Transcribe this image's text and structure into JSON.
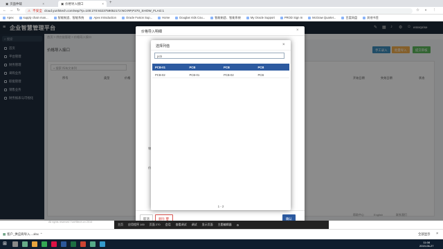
{
  "browser": {
    "tabs": [
      {
        "label": "页面仲裁",
        "active": false
      },
      {
        "label": "价格导入接口",
        "active": true
      }
    ],
    "insecure_label": "不安全",
    "url": "cloud.yunhitech.com/sep/?p=100:270:9323759052172:NO:RP,P270_SHOW_FLAG:1",
    "bookmarks": [
      "Apex",
      "supply chain man...",
      "智能制造、智能系统",
      "Apex Introduction",
      "Oracle Fusion Sup...",
      "Home",
      "Douglas Vids Cou...",
      "智能制造、智能系统",
      "My Oracle Support",
      "PROD Sign In",
      "McGraw Quarter...",
      "百度网盘",
      "其他书签"
    ]
  },
  "app": {
    "title": "企业智慧管理平台",
    "user": "enterprise"
  },
  "sidebar": {
    "search_placeholder": "搜索",
    "items": [
      {
        "label": "首页",
        "active": false
      },
      {
        "label": "平台管理",
        "active": false
      },
      {
        "label": "财务管理",
        "active": false
      },
      {
        "label": "采购业务",
        "active": false
      },
      {
        "label": "职能管理",
        "active": false
      },
      {
        "label": "销售业务",
        "active": false
      },
      {
        "label": "财务报表与可视化",
        "active": false
      }
    ]
  },
  "breadcrumb": "首页 > 供应链管理 > 价格导入接口",
  "page": {
    "title": "价格导入接口",
    "buttons": [
      "手工录入",
      "批量导入",
      "提交审核"
    ],
    "search_placeholder": "搜索 所有文本列",
    "columns": [
      "序号",
      "类型",
      "价格",
      "开始日期",
      "失效日期",
      "状态"
    ],
    "footer_copy": "All rights reserved YunHitech.cn 2014",
    "footer_links": [
      "帮助中心",
      "English",
      "联系我们"
    ]
  },
  "outer_modal": {
    "title": "价格导入明细",
    "labels": [
      "物料",
      "价格"
    ],
    "cancel_label": "取消",
    "delete_label": "删除",
    "confirm_label": "确认"
  },
  "inner_dialog": {
    "title": "选择列值",
    "search_value": "pcb",
    "rows": [
      [
        "PCB-01",
        "PCB",
        "PCB",
        "PCB"
      ],
      [
        "PCB-02",
        "PCB-01",
        "PCB-02",
        "PCB"
      ]
    ],
    "selected_row": 0,
    "pager": "1 - 2"
  },
  "devbar": [
    "主页",
    "应用程序 100",
    "页面 270",
    "会话",
    "查看调试",
    "调试",
    "显示页面",
    "主题编辑器"
  ],
  "downloads": [
    {
      "name": "客户_供应商导入....xlsx"
    }
  ],
  "downloads_all": "全部显示",
  "taskbar": {
    "time": "11:08",
    "date": "2019-06-27"
  },
  "colors": {
    "accent": "#2c5aa0",
    "header": "#1e2a3a",
    "sidebar": "#1f2d3d",
    "btn_blue": "#3c8dbc",
    "btn_yellow": "#f0ad4e",
    "btn_green": "#5cb85c"
  }
}
